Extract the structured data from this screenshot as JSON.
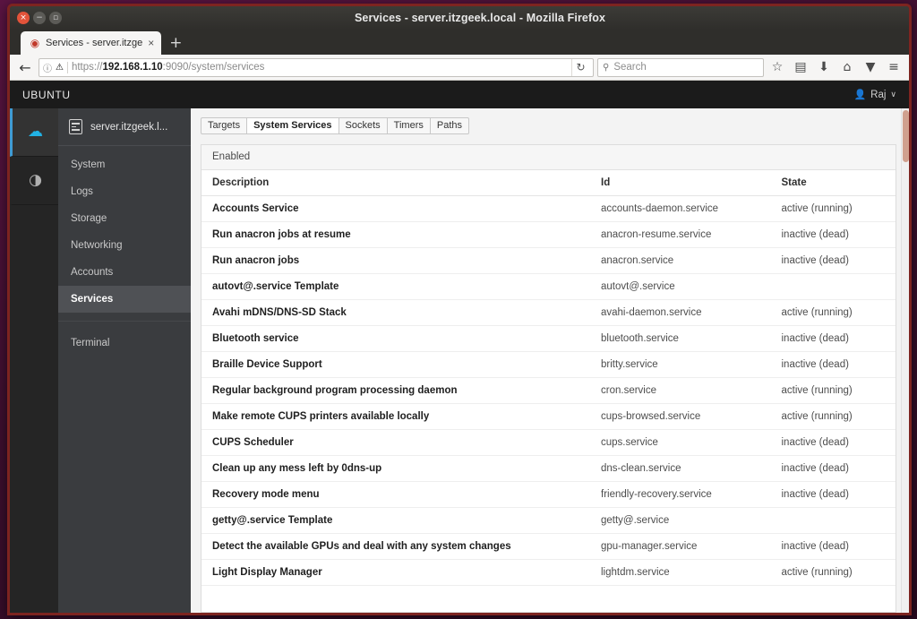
{
  "window": {
    "title": "Services - server.itzgeek.local - Mozilla Firefox",
    "close_label": "×",
    "minimize_label": "−",
    "maximize_label": "▫"
  },
  "browser": {
    "tab": {
      "favicon": "firefox-favicon",
      "title": "Services - server.itzge",
      "close_label": "×"
    },
    "new_tab_label": "+",
    "toolbar": {
      "back_label": "←",
      "reload_label": "↻",
      "bookmark_label": "☆",
      "library_label": "▤",
      "downloads_label": "⬇",
      "home_label": "⌂",
      "pocket_label": "▼",
      "menu_label": "≡"
    },
    "url": {
      "identity_label": "ⓘ",
      "lock_label": "🔒",
      "scheme": "https://",
      "host": "192.168.1.10",
      "rest": ":9090/system/services",
      "go_label": "⟳"
    },
    "search": {
      "icon": "search-icon",
      "placeholder": "Search"
    }
  },
  "cockpit": {
    "brand": "UBUNTU",
    "user": {
      "name": "Raj",
      "caret": "∨"
    },
    "rail": [
      {
        "name": "dashboard-cloud",
        "glyph": "☁",
        "active": true
      },
      {
        "name": "machines-gauge",
        "glyph": "◔",
        "active": false
      }
    ],
    "host": {
      "name": "server.itzgeek.l..."
    },
    "nav_items": [
      {
        "label": "System",
        "active": false
      },
      {
        "label": "Logs",
        "active": false
      },
      {
        "label": "Storage",
        "active": false
      },
      {
        "label": "Networking",
        "active": false
      },
      {
        "label": "Accounts",
        "active": false
      },
      {
        "label": "Services",
        "active": true
      },
      {
        "label": "Terminal",
        "active": false
      }
    ],
    "tabs": [
      {
        "label": "Targets",
        "active": false
      },
      {
        "label": "System Services",
        "active": true
      },
      {
        "label": "Sockets",
        "active": false
      },
      {
        "label": "Timers",
        "active": false
      },
      {
        "label": "Paths",
        "active": false
      }
    ],
    "panel": {
      "section_title": "Enabled",
      "columns": {
        "description": "Description",
        "id": "Id",
        "state": "State"
      },
      "rows": [
        {
          "description": "Accounts Service",
          "id": "accounts-daemon.service",
          "state": "active (running)"
        },
        {
          "description": "Run anacron jobs at resume",
          "id": "anacron-resume.service",
          "state": "inactive (dead)"
        },
        {
          "description": "Run anacron jobs",
          "id": "anacron.service",
          "state": "inactive (dead)"
        },
        {
          "description": "autovt@.service Template",
          "id": "autovt@.service",
          "state": ""
        },
        {
          "description": "Avahi mDNS/DNS-SD Stack",
          "id": "avahi-daemon.service",
          "state": "active (running)"
        },
        {
          "description": "Bluetooth service",
          "id": "bluetooth.service",
          "state": "inactive (dead)"
        },
        {
          "description": "Braille Device Support",
          "id": "britty.service",
          "state": "inactive (dead)"
        },
        {
          "description": "Regular background program processing daemon",
          "id": "cron.service",
          "state": "active (running)"
        },
        {
          "description": "Make remote CUPS printers available locally",
          "id": "cups-browsed.service",
          "state": "active (running)"
        },
        {
          "description": "CUPS Scheduler",
          "id": "cups.service",
          "state": "inactive (dead)"
        },
        {
          "description": "Clean up any mess left by 0dns-up",
          "id": "dns-clean.service",
          "state": "inactive (dead)"
        },
        {
          "description": "Recovery mode menu",
          "id": "friendly-recovery.service",
          "state": "inactive (dead)"
        },
        {
          "description": "getty@.service Template",
          "id": "getty@.service",
          "state": ""
        },
        {
          "description": "Detect the available GPUs and deal with any system changes",
          "id": "gpu-manager.service",
          "state": "inactive (dead)"
        },
        {
          "description": "Light Display Manager",
          "id": "lightdm.service",
          "state": "active (running)"
        }
      ]
    }
  }
}
